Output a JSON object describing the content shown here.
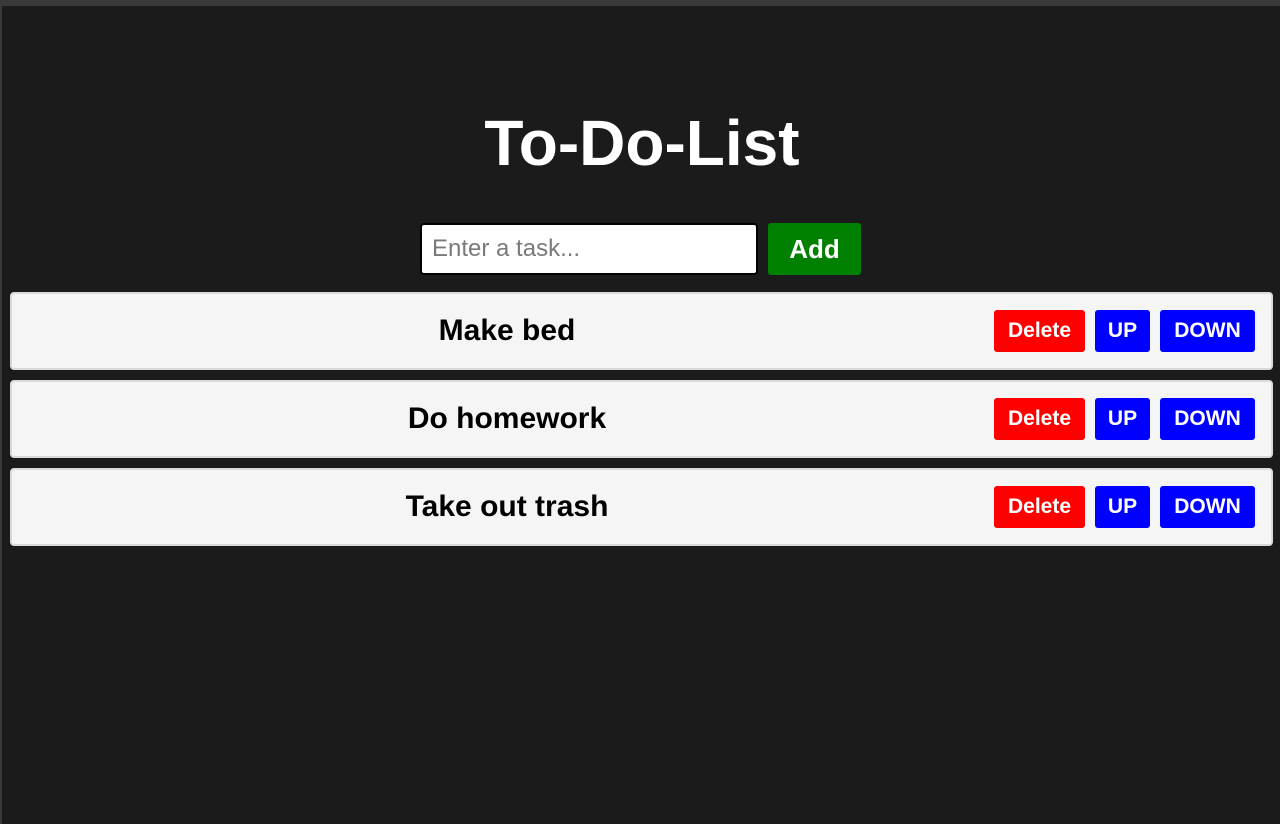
{
  "title": "To-Do-List",
  "input": {
    "placeholder": "Enter a task...",
    "value": ""
  },
  "add_label": "Add",
  "tasks": [
    {
      "text": "Make bed",
      "delete_label": "Delete",
      "up_label": "UP",
      "down_label": "DOWN"
    },
    {
      "text": "Do homework",
      "delete_label": "Delete",
      "up_label": "UP",
      "down_label": "DOWN"
    },
    {
      "text": "Take out trash",
      "delete_label": "Delete",
      "up_label": "UP",
      "down_label": "DOWN"
    }
  ],
  "colors": {
    "background": "#1b1b1b",
    "add_button": "#008000",
    "delete_button": "#ff0000",
    "move_button": "#0000ff",
    "item_background": "#f5f5f5"
  }
}
